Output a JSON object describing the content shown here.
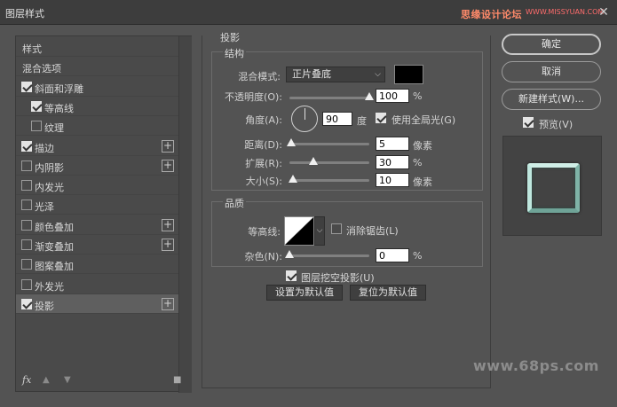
{
  "window": {
    "title": "图层样式",
    "brand_text": "思缘设计论坛",
    "brand_url": "WWW.MISSYUAN.COM",
    "close_glyph": "✕"
  },
  "styles_panel": {
    "items": [
      {
        "label": "样式",
        "checkbox": false,
        "checked": false,
        "plus": false
      },
      {
        "label": "混合选项",
        "checkbox": false,
        "checked": false,
        "plus": false
      },
      {
        "label": "斜面和浮雕",
        "checkbox": true,
        "checked": true,
        "plus": false
      },
      {
        "label": "等高线",
        "checkbox": true,
        "checked": true,
        "plus": false,
        "indent": true
      },
      {
        "label": "纹理",
        "checkbox": true,
        "checked": false,
        "plus": false,
        "indent": true
      },
      {
        "label": "描边",
        "checkbox": true,
        "checked": true,
        "plus": true
      },
      {
        "label": "内阴影",
        "checkbox": true,
        "checked": false,
        "plus": true
      },
      {
        "label": "内发光",
        "checkbox": true,
        "checked": false,
        "plus": false
      },
      {
        "label": "光泽",
        "checkbox": true,
        "checked": false,
        "plus": false
      },
      {
        "label": "颜色叠加",
        "checkbox": true,
        "checked": false,
        "plus": true
      },
      {
        "label": "渐变叠加",
        "checkbox": true,
        "checked": false,
        "plus": true
      },
      {
        "label": "图案叠加",
        "checkbox": true,
        "checked": false,
        "plus": false
      },
      {
        "label": "外发光",
        "checkbox": true,
        "checked": false,
        "plus": false
      },
      {
        "label": "投影",
        "checkbox": true,
        "checked": true,
        "plus": true,
        "selected": true
      }
    ],
    "plus_glyph": "+",
    "fx_label": "fx",
    "up_glyph": "▲",
    "down_glyph": "▼",
    "trash_glyph": "🗑"
  },
  "drop_shadow": {
    "section_title": "投影",
    "structure": {
      "title": "结构",
      "blend_mode_label": "混合模式:",
      "blend_mode_value": "正片叠底",
      "shadow_color": "#000000",
      "opacity_label": "不透明度(O):",
      "opacity_value": "100",
      "opacity_fraction": 1.0,
      "percent": "%",
      "angle_label": "角度(A):",
      "angle_value": "90",
      "degree_unit": "度",
      "global_light_label": "使用全局光(G)",
      "global_light_checked": true,
      "distance_label": "距离(D):",
      "distance_value": "5",
      "distance_fraction": 0.02,
      "pixel_unit": "像素",
      "spread_label": "扩展(R):",
      "spread_value": "30",
      "spread_fraction": 0.3,
      "size_label": "大小(S):",
      "size_value": "10",
      "size_fraction": 0.04
    },
    "quality": {
      "title": "品质",
      "contour_label": "等高线:",
      "antialias_label": "消除锯齿(L)",
      "antialias_checked": false,
      "noise_label": "杂色(N):",
      "noise_value": "0",
      "noise_fraction": 0.0,
      "percent": "%"
    },
    "knockout_label": "图层挖空投影(U)",
    "knockout_checked": true,
    "make_default_label": "设置为默认值",
    "reset_default_label": "复位为默认值"
  },
  "right_panel": {
    "ok_label": "确定",
    "cancel_label": "取消",
    "new_style_label": "新建样式(W)...",
    "preview_label": "预览(V)",
    "preview_checked": true
  },
  "watermark": "www.68ps.com",
  "colors": {
    "preview_frame": "#9fd3c7"
  }
}
